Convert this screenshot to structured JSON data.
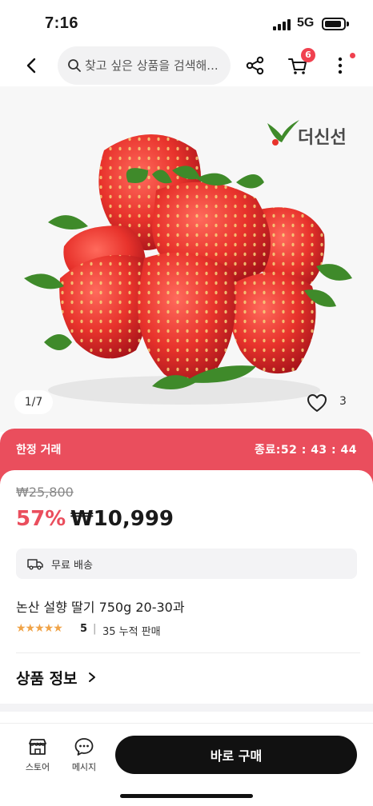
{
  "status_bar": {
    "time": "7:16",
    "network": "5G"
  },
  "header": {
    "search_placeholder": "찾고 싶은 상품을 검색해...",
    "cart_count": "6"
  },
  "gallery": {
    "brand": "더신선",
    "page_indicator": "1/7",
    "like_count": "3"
  },
  "deal": {
    "label": "한정 거래",
    "timer": "종료:52 : 43 : 44"
  },
  "product": {
    "original_price": "₩25,800",
    "discount": "57%",
    "sale_price": "₩10,999",
    "shipping": "무료 배송",
    "title": "논산 설향 딸기 750g 20-30과",
    "stars": "★★★★★",
    "rating": "5",
    "separator": "|",
    "sales": "35 누적 판매",
    "info_link": "상품 정보"
  },
  "bottom_bar": {
    "store_label": "스토어",
    "message_label": "메시지",
    "buy_label": "바로 구매"
  },
  "colors": {
    "accent": "#ea4e5d",
    "badge": "#f0414f",
    "star": "#f0a347",
    "buy_button": "#111111"
  },
  "icons": [
    "back-arrow-icon",
    "search-icon",
    "share-icon",
    "cart-icon",
    "more-vertical-icon",
    "heart-icon",
    "truck-icon",
    "chevron-right-icon",
    "store-icon",
    "message-icon"
  ]
}
